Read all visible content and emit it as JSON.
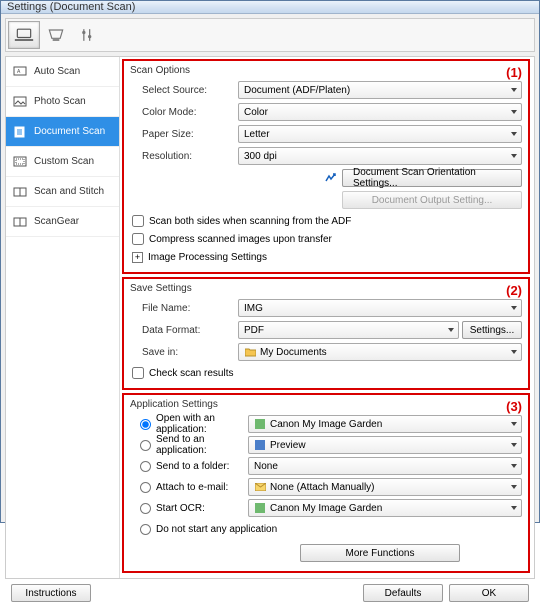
{
  "window": {
    "title": "Settings (Document Scan)"
  },
  "sidebar": {
    "items": [
      {
        "label": "Auto Scan"
      },
      {
        "label": "Photo Scan"
      },
      {
        "label": "Document Scan"
      },
      {
        "label": "Custom Scan"
      },
      {
        "label": "Scan and Stitch"
      },
      {
        "label": "ScanGear"
      }
    ]
  },
  "section1": {
    "num": "(1)",
    "title": "Scan Options",
    "select_source_label": "Select Source:",
    "select_source_value": "Document (ADF/Platen)",
    "color_mode_label": "Color Mode:",
    "color_mode_value": "Color",
    "paper_size_label": "Paper Size:",
    "paper_size_value": "Letter",
    "resolution_label": "Resolution:",
    "resolution_value": "300 dpi",
    "orientation_btn": "Document Scan Orientation Settings...",
    "output_btn": "Document Output Setting...",
    "chk_both_sides": "Scan both sides when scanning from the ADF",
    "chk_compress": "Compress scanned images upon transfer",
    "img_proc": "Image Processing Settings"
  },
  "section2": {
    "num": "(2)",
    "title": "Save Settings",
    "filename_label": "File Name:",
    "filename_value": "IMG",
    "dataformat_label": "Data Format:",
    "dataformat_value": "PDF",
    "settings_btn": "Settings...",
    "savein_label": "Save in:",
    "savein_value": "My Documents",
    "chk_check_results": "Check scan results"
  },
  "section3": {
    "num": "(3)",
    "title": "Application Settings",
    "open_app_label": "Open with an application:",
    "open_app_value": "Canon My Image Garden",
    "send_app_label": "Send to an application:",
    "send_app_value": "Preview",
    "send_folder_label": "Send to a folder:",
    "send_folder_value": "None",
    "attach_email_label": "Attach to e-mail:",
    "attach_email_value": "None (Attach Manually)",
    "start_ocr_label": "Start OCR:",
    "start_ocr_value": "Canon My Image Garden",
    "do_not_start_label": "Do not start any application",
    "more_functions_btn": "More Functions"
  },
  "footer": {
    "instructions": "Instructions",
    "defaults": "Defaults",
    "ok": "OK"
  }
}
